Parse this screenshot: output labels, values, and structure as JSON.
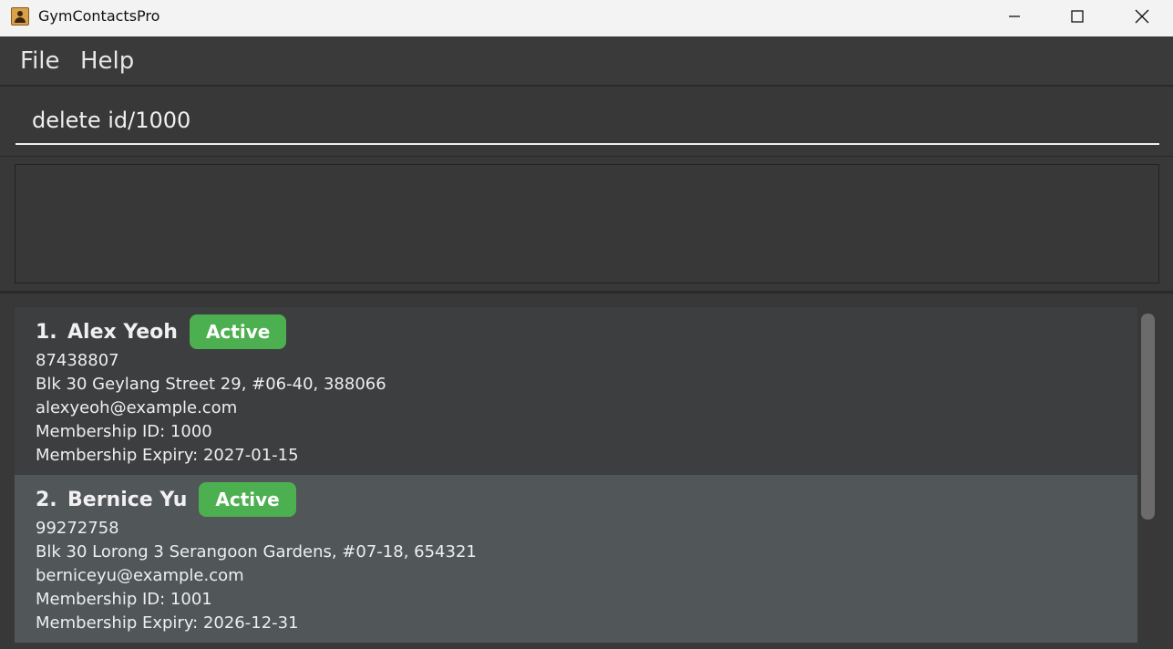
{
  "window": {
    "title": "GymContactsPro",
    "minimize_icon": "minimize-icon",
    "maximize_icon": "maximize-icon",
    "close_icon": "close-icon"
  },
  "menu": {
    "file": "File",
    "help": "Help"
  },
  "command": {
    "value": "delete id/1000"
  },
  "result": {
    "text": ""
  },
  "persons": [
    {
      "index": "1.",
      "name": "Alex Yeoh",
      "status": "Active",
      "phone": "87438807",
      "address": "Blk 30 Geylang Street 29, #06-40, 388066",
      "email": "alexyeoh@example.com",
      "membership_id": "Membership ID: 1000",
      "membership_expiry": "Membership Expiry: 2027-01-15"
    },
    {
      "index": "2.",
      "name": "Bernice Yu",
      "status": "Active",
      "phone": "99272758",
      "address": "Blk 30 Lorong 3 Serangoon Gardens, #07-18, 654321",
      "email": "berniceyu@example.com",
      "membership_id": "Membership ID: 1001",
      "membership_expiry": "Membership Expiry: 2026-12-31"
    }
  ],
  "colors": {
    "active_badge": "#4caf50",
    "selected_card": "#515659",
    "card": "#3c3e40",
    "background": "#383838"
  }
}
